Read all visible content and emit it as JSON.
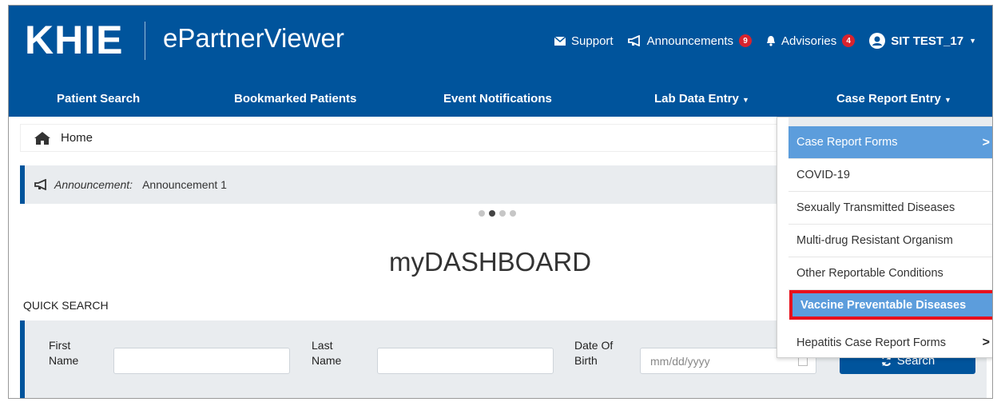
{
  "header": {
    "logo_text": "KHIE",
    "app_title": "ePartnerViewer",
    "support": "Support",
    "announcements": "Announcements",
    "announcements_count": "9",
    "advisories": "Advisories",
    "advisories_count": "4",
    "user": "SIT TEST_17"
  },
  "nav": {
    "patient_search": "Patient Search",
    "bookmarked": "Bookmarked Patients",
    "events": "Event Notifications",
    "lab": "Lab Data Entry",
    "case_report": "Case Report Entry"
  },
  "breadcrumb": {
    "home": "Home"
  },
  "announcement": {
    "label": "Announcement:",
    "text": "Announcement 1"
  },
  "carousel": {
    "active_index": 1,
    "count": 4
  },
  "dashboard": {
    "title": "myDASHBOARD"
  },
  "quick_search": {
    "label": "QUICK SEARCH",
    "first_name_l1": "First",
    "first_name_l2": "Name",
    "last_name_l1": "Last",
    "last_name_l2": "Name",
    "dob_l1": "Date Of",
    "dob_l2": "Birth",
    "dob_placeholder": "mm/dd/yyyy",
    "search_button": "Search"
  },
  "dropdown": {
    "items": [
      "Case Report Forms",
      "COVID-19",
      "Sexually Transmitted Diseases",
      "Multi-drug Resistant Organism",
      "Other Reportable Conditions",
      "Vaccine Preventable Diseases",
      "Hepatitis Case Report Forms"
    ]
  },
  "colors": {
    "brand_blue": "#00549c",
    "highlight_blue": "#5c9ddc",
    "badge_red": "#d9232e",
    "annotation_red": "#e8101c"
  }
}
